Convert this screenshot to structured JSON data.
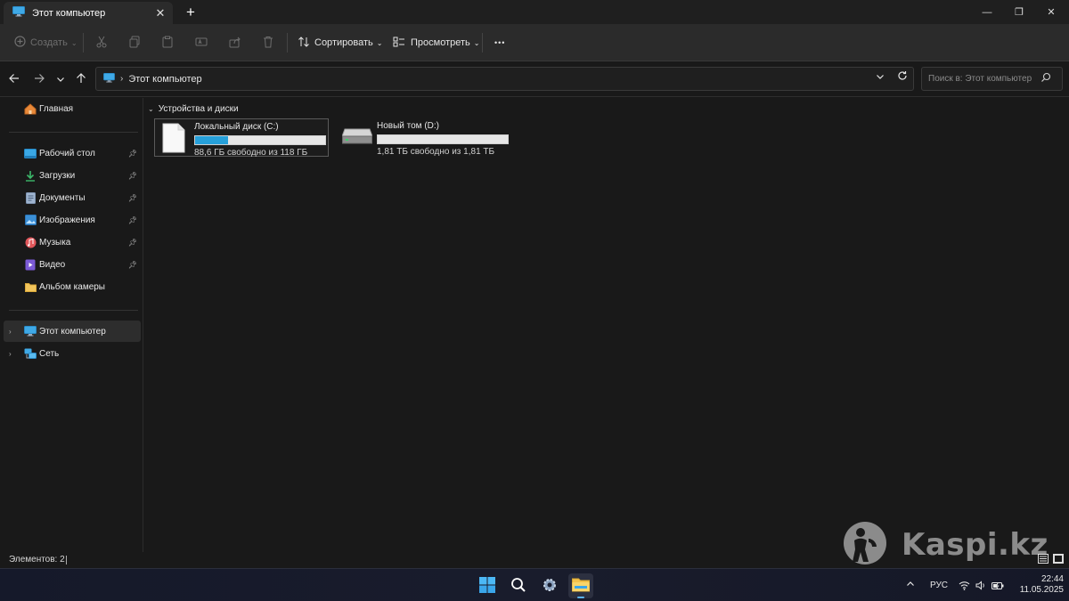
{
  "window": {
    "tab_title": "Этот компьютер",
    "tab_close": "✕",
    "new_tab": "+",
    "minimize": "—",
    "maximize": "❐",
    "close": "✕"
  },
  "toolbar": {
    "create_label": "Создать",
    "sort_label": "Сортировать",
    "view_label": "Просмотреть",
    "more_label": "•••"
  },
  "address": {
    "crumb": "Этот компьютер",
    "search_placeholder": "Поиск в: Этот компьютер"
  },
  "sidebar": {
    "home": "Главная",
    "quick_access": [
      {
        "label": "Рабочий стол",
        "icon": "desktop-icon",
        "pinned": true
      },
      {
        "label": "Загрузки",
        "icon": "downloads-icon",
        "pinned": true
      },
      {
        "label": "Документы",
        "icon": "documents-icon",
        "pinned": true
      },
      {
        "label": "Изображения",
        "icon": "pictures-icon",
        "pinned": true
      },
      {
        "label": "Музыка",
        "icon": "music-icon",
        "pinned": true
      },
      {
        "label": "Видео",
        "icon": "videos-icon",
        "pinned": true
      },
      {
        "label": "Альбом камеры",
        "icon": "folder-icon",
        "pinned": false
      }
    ],
    "this_pc": "Этот компьютер",
    "network": "Сеть"
  },
  "content": {
    "group_title": "Устройства и диски",
    "drives": [
      {
        "name": "Локальный диск (C:)",
        "free_text": "88,6 ГБ свободно из 118 ГБ",
        "used_fraction": 0.25,
        "selected": true
      },
      {
        "name": "Новый том (D:)",
        "free_text": "1,81 ТБ свободно из 1,81 ТБ",
        "used_fraction": 0.0,
        "selected": false
      }
    ]
  },
  "status": {
    "items_text": "Элементов: 2"
  },
  "watermark": {
    "text": "Kaspi.kz"
  },
  "taskbar": {
    "language": "РУС",
    "time": "22:44",
    "date": "11.05.2025"
  },
  "colors": {
    "accent": "#26a0da",
    "background": "#191919",
    "toolbar": "#2b2b2b"
  }
}
